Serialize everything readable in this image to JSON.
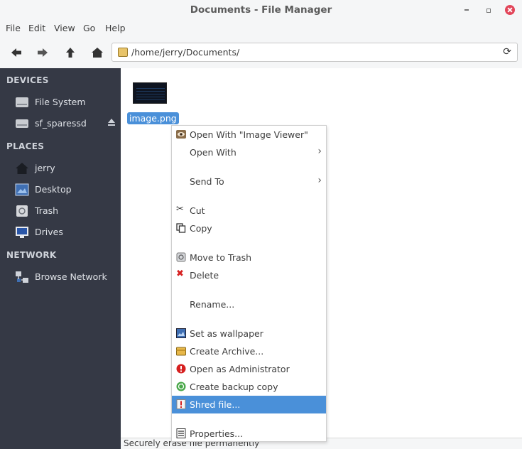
{
  "window": {
    "title": "Documents - File Manager"
  },
  "menubar": [
    "File",
    "Edit",
    "View",
    "Go",
    "Help"
  ],
  "toolbar": {
    "path": "/home/jerry/Documents/"
  },
  "sidebar": {
    "devices_heading": "DEVICES",
    "devices": [
      {
        "label": "File System",
        "icon": "harddisk-icon"
      },
      {
        "label": "sf_sparessd",
        "icon": "drive-icon"
      }
    ],
    "places_heading": "PLACES",
    "places": [
      {
        "label": "jerry",
        "icon": "home-icon"
      },
      {
        "label": "Desktop",
        "icon": "desktop-icon"
      },
      {
        "label": "Trash",
        "icon": "trash-icon"
      },
      {
        "label": "Drives",
        "icon": "monitor-icon"
      }
    ],
    "network_heading": "NETWORK",
    "network": [
      {
        "label": "Browse Network",
        "icon": "network-icon"
      }
    ]
  },
  "main": {
    "file": {
      "name": "image.png"
    }
  },
  "context_menu": {
    "items": [
      {
        "label": "Open With \"Image Viewer\"",
        "icon": "image-viewer-icon"
      },
      {
        "label": "Open With",
        "submenu": true
      },
      {
        "label": "Send To",
        "submenu": true
      },
      {
        "label": "Cut",
        "icon": "scissors-icon"
      },
      {
        "label": "Copy",
        "icon": "copy-icon"
      },
      {
        "label": "Move to Trash",
        "icon": "trash-icon"
      },
      {
        "label": "Delete",
        "icon": "delete-icon"
      },
      {
        "label": "Rename..."
      },
      {
        "label": "Set as wallpaper",
        "icon": "wallpaper-icon"
      },
      {
        "label": "Create Archive...",
        "icon": "archive-icon"
      },
      {
        "label": "Open as Administrator",
        "icon": "admin-icon"
      },
      {
        "label": "Create backup copy",
        "icon": "backup-icon"
      },
      {
        "label": "Shred file...",
        "icon": "shred-icon",
        "active": true
      },
      {
        "label": "Properties...",
        "icon": "properties-icon"
      }
    ]
  },
  "statusbar": {
    "text": "Securely erase file permanently"
  },
  "colors": {
    "sidebar_bg": "#353945",
    "selection": "#4a90d9",
    "close_button": "#e2465a"
  }
}
